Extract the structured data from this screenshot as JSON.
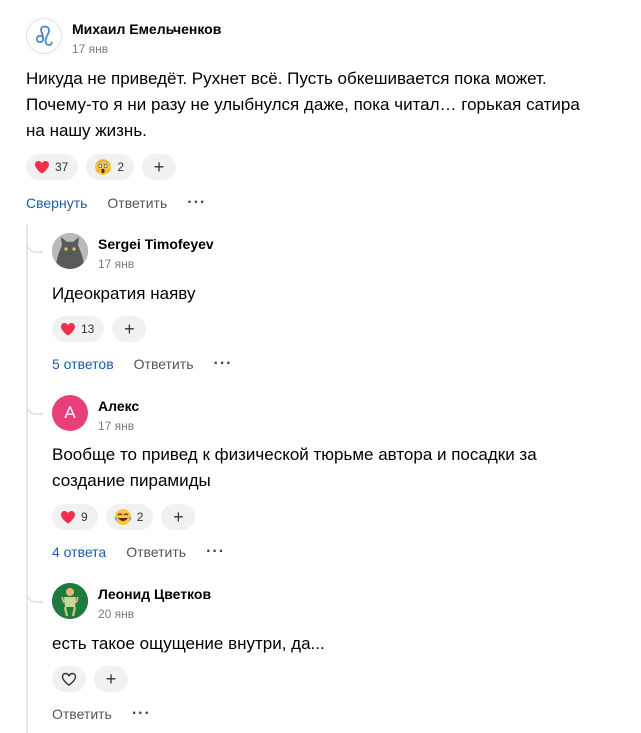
{
  "comments": [
    {
      "author": "Михаил Емельченков",
      "date": "17 янв",
      "text_lines": [
        "Никуда не приведёт. Рухнет всё. Пусть обкешивается пока может.",
        "Почему-то я ни разу не улыбнулся даже, пока читал… горькая сатира",
        "на нашу жизнь."
      ],
      "reactions": [
        {
          "icon": "heart",
          "count": "37"
        },
        {
          "icon": "scream-face",
          "count": "2"
        }
      ],
      "collapse_label": "Свернуть",
      "reply_label": "Ответить"
    },
    {
      "author": "Sergei Timofeyev",
      "date": "17 янв",
      "text_lines": [
        "Идеократия наяву"
      ],
      "reactions": [
        {
          "icon": "heart",
          "count": "13"
        }
      ],
      "replies_label": "5 ответов",
      "reply_label": "Ответить"
    },
    {
      "author": "Алекс",
      "avatar_letter": "А",
      "date": "17 янв",
      "text_lines": [
        "Вообще то привед к физической тюрьме автора и посадки за",
        "создание пирамиды"
      ],
      "reactions": [
        {
          "icon": "heart",
          "count": "9"
        },
        {
          "icon": "laugh-tears-face",
          "count": "2"
        }
      ],
      "replies_label": "4 ответа",
      "reply_label": "Ответить"
    },
    {
      "author": "Леонид Цветков",
      "date": "20 янв",
      "text_lines": [
        "есть такое ощущение внутри, да..."
      ],
      "reactions": [],
      "reply_label": "Ответить"
    }
  ],
  "plus_label": "+",
  "more_label": "···",
  "colors": {
    "accent": "#1a5dab",
    "heart": "#f0304d",
    "avatar_alex": "#e83e7a"
  }
}
